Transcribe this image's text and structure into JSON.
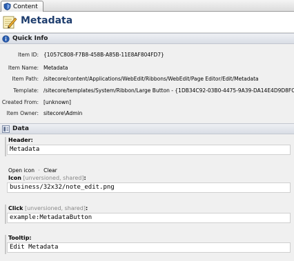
{
  "tab": {
    "label": "Content"
  },
  "title": "Metadata",
  "quick_info": {
    "title": "Quick Info",
    "rows": [
      {
        "label": "Item ID:",
        "value": "{1057C808-F7B8-458B-A85B-11E8AF804FD7}"
      },
      {
        "label": "Item Name:",
        "value": "Metadata"
      },
      {
        "label": "Item Path:",
        "value": "/sitecore/content/Applications/WebEdit/Ribbons/WebEdit/Page Editor/Edit/Metadata"
      },
      {
        "label": "Template:",
        "value": "/sitecore/templates/System/Ribbon/Large Button - {1DB34C92-03B0-4475-9A39-DA14E4D9D8FC}"
      },
      {
        "label": "Created From:",
        "value": "[unknown]"
      },
      {
        "label": "Item Owner:",
        "value": "sitecore\\Admin"
      }
    ]
  },
  "data": {
    "title": "Data",
    "header_field": {
      "label": "Header:",
      "value": "Metadata"
    },
    "icon_links": {
      "open": "Open icon",
      "separator": "·",
      "clear": "Clear"
    },
    "icon_field": {
      "label": "Icon",
      "meta": "[unversioned, shared]",
      "colon": ":",
      "value": "business/32x32/note_edit.png"
    },
    "click_field": {
      "label": "Click",
      "meta": "[unversioned, shared]",
      "colon": ":",
      "value": "example:MetadataButton"
    },
    "tooltip_field": {
      "label": "Tooltip:",
      "value": "Edit Metadata"
    }
  },
  "colors": {
    "title": "#1f3e6e",
    "section_bg": "#d9dde5",
    "panel_bg": "#f0f0f0"
  }
}
